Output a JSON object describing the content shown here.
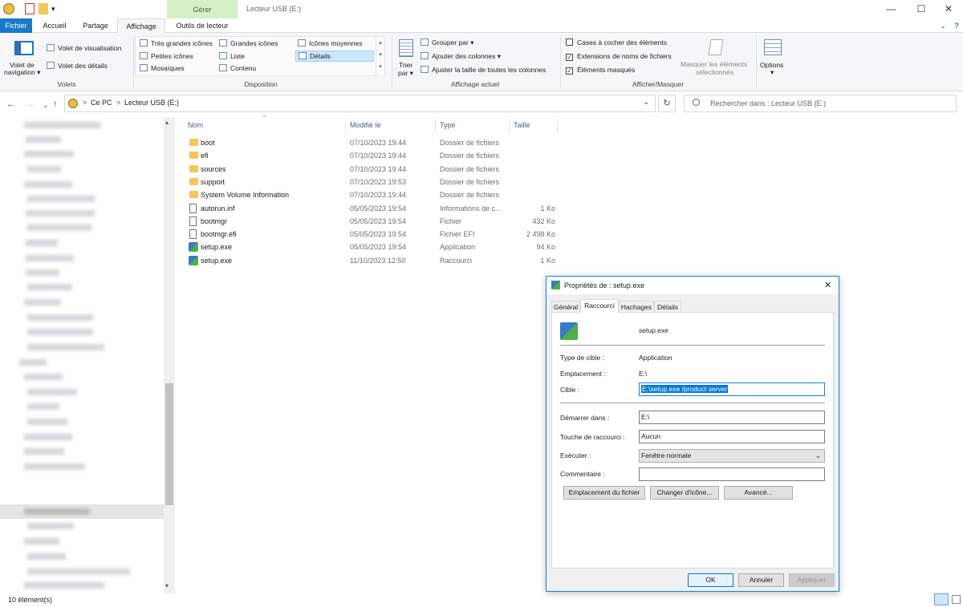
{
  "window": {
    "title": "Lecteur USB (E:)",
    "contextual_group": "Gérer",
    "controls": {
      "minimize": "—",
      "maximize": "☐",
      "close": "✕"
    },
    "collapse": "⌄",
    "help": "?"
  },
  "ribbon_tabs": [
    "Fichier",
    "Accueil",
    "Partage",
    "Affichage",
    "Outils de lecteur"
  ],
  "ribbon": {
    "volets": {
      "nav_pane": "Volet de\nnavigation",
      "nav_pane_l1": "Volet de",
      "nav_pane_l2": "navigation ▾",
      "preview": "Volet de visualisation",
      "details": "Volet des détails",
      "group": "Volets"
    },
    "disposition": {
      "items": [
        "Très grandes icônes",
        "Grandes icônes",
        "Icônes moyennes",
        "Petites icônes",
        "Liste",
        "Détails",
        "Mosaïques",
        "Contenu"
      ],
      "group": "Disposition"
    },
    "affichage_actuel": {
      "sort_l1": "Trier",
      "sort_l2": "par ▾",
      "group_by": "Grouper par ▾",
      "add_columns": "Ajouter des colonnes ▾",
      "fit_columns": "Ajuster la taille de toutes les colonnes",
      "group": "Affichage actuel"
    },
    "afficher_masquer": {
      "checkboxes": "Cases à cocher des éléments",
      "extensions": "Extensions de noms de fichiers",
      "hidden": "Éléments masqués",
      "hide_selected_l1": "Masquer les éléments",
      "hide_selected_l2": "sélectionnés",
      "group": "Afficher/Masquer"
    },
    "options": {
      "label": "Options",
      "arrow": "▾"
    }
  },
  "address": {
    "back": "←",
    "forward": "→",
    "recent": "⌄",
    "up": "↑",
    "breadcrumb": [
      "Ce PC",
      "Lecteur USB (E:)"
    ],
    "sep": ">",
    "dropdown": "⌄",
    "refresh": "↻",
    "search_placeholder": "Rechercher dans : Lecteur USB (E:)"
  },
  "columns": {
    "name": "Nom",
    "modified": "Modifié le",
    "type": "Type",
    "size": "Taille"
  },
  "files": [
    {
      "name": "boot",
      "date": "07/10/2023 19:44",
      "type": "Dossier de fichiers",
      "size": "",
      "icon": "folder"
    },
    {
      "name": "efi",
      "date": "07/10/2023 19:44",
      "type": "Dossier de fichiers",
      "size": "",
      "icon": "folder"
    },
    {
      "name": "sources",
      "date": "07/10/2023 19:44",
      "type": "Dossier de fichiers",
      "size": "",
      "icon": "folder"
    },
    {
      "name": "support",
      "date": "07/10/2023 19:53",
      "type": "Dossier de fichiers",
      "size": "",
      "icon": "folder"
    },
    {
      "name": "System Volume Information",
      "date": "07/10/2023 19:44",
      "type": "Dossier de fichiers",
      "size": "",
      "icon": "folder"
    },
    {
      "name": "autorun.inf",
      "date": "05/05/2023 19:54",
      "type": "Informations de c...",
      "size": "1 Ko",
      "icon": "doc"
    },
    {
      "name": "bootmgr",
      "date": "05/05/2023 19:54",
      "type": "Fichier",
      "size": "432 Ko",
      "icon": "doc"
    },
    {
      "name": "bootmgr.efi",
      "date": "05/05/2023 19:54",
      "type": "Fichier EFI",
      "size": "2 498 Ko",
      "icon": "doc"
    },
    {
      "name": "setup.exe",
      "date": "05/05/2023 19:54",
      "type": "Application",
      "size": "94 Ko",
      "icon": "exe"
    },
    {
      "name": "setup.exe",
      "date": "11/10/2023 12:50",
      "type": "Raccourci",
      "size": "1 Ko",
      "icon": "exe"
    }
  ],
  "status": {
    "count": "10 élément(s)"
  },
  "dialog": {
    "title": "Propriétés de : setup.exe",
    "close": "✕",
    "tabs": [
      "Général",
      "Raccourci",
      "Hachages",
      "Détails"
    ],
    "name": "setup.exe",
    "target_type_label": "Type de cible :",
    "target_type": "Application",
    "location_label": "Emplacement :",
    "location": "E:\\",
    "target_label": "Cible :",
    "target": "E:\\setup.exe /product server",
    "start_in_label": "Démarrer dans :",
    "start_in": "E:\\",
    "shortcut_label": "Touche de raccourci :",
    "shortcut": "Aucun",
    "run_label": "Exécuter :",
    "run": "Fenêtre normale",
    "comment_label": "Commentaire :",
    "comment": "",
    "btn_location": "Emplacement du fichier",
    "btn_icon": "Changer d'icône...",
    "btn_advanced": "Avancé...",
    "ok": "OK",
    "cancel": "Annuler",
    "apply": "Appliquer"
  }
}
